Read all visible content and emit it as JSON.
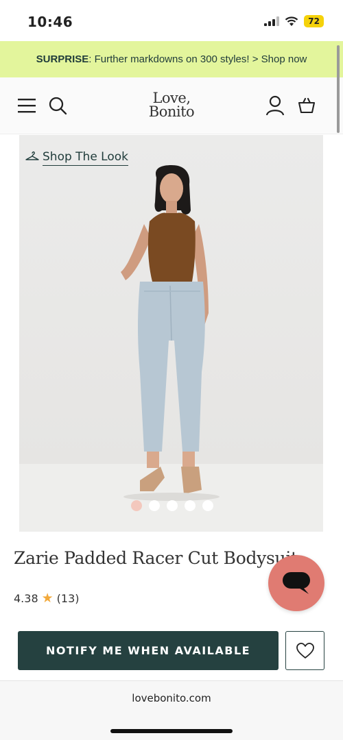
{
  "status_bar": {
    "time": "10:46",
    "battery": "72"
  },
  "promo": {
    "bold": "SURPRISE",
    "text": ": Further markdowns on 300 styles! > Shop now"
  },
  "header": {
    "logo_line1": "Love,",
    "logo_line2": "Bonito"
  },
  "product": {
    "shop_the_look": "Shop The Look",
    "title": "Zarie Padded Racer Cut Bodysuit",
    "rating": "4.38",
    "review_count": "(13)",
    "image_count": 5,
    "active_image": 1
  },
  "actions": {
    "notify_label": "NOTIFY ME WHEN AVAILABLE"
  },
  "browser": {
    "url": "lovebonito.com"
  },
  "colors": {
    "accent": "#254140",
    "promo_bg": "#e3f59c",
    "chat": "#e07b72",
    "star": "#f2a93b",
    "top": "#7a4a22",
    "jeans": "#b7c7d3"
  }
}
